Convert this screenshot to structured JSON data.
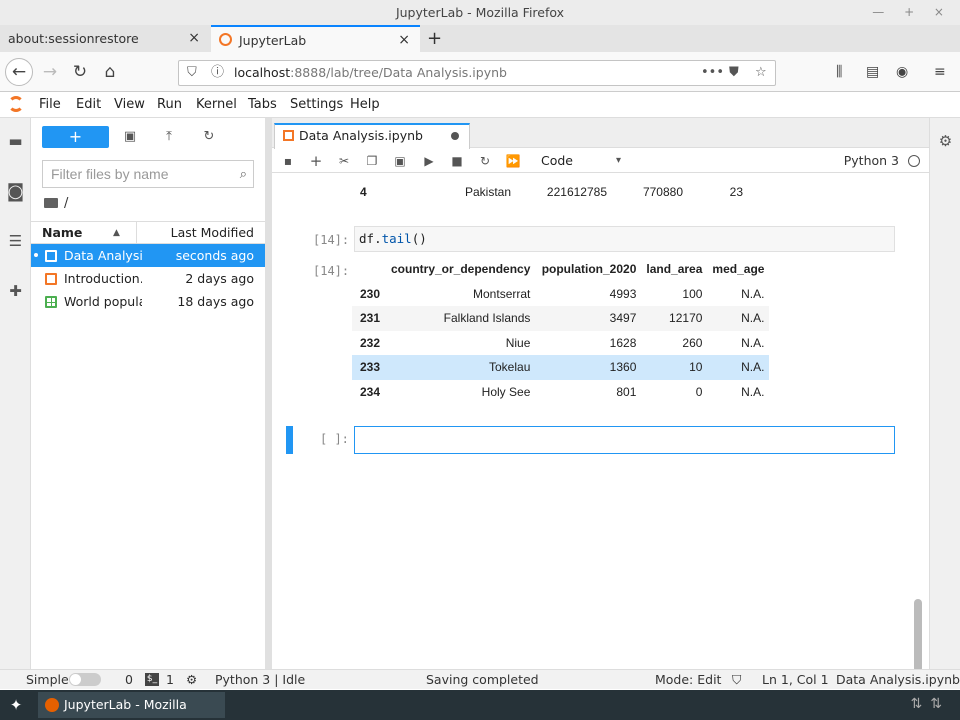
{
  "window": {
    "title": "JupyterLab - Mozilla Firefox",
    "controls": "— + ×"
  },
  "browser_tabs": [
    {
      "label": "about:sessionrestore"
    },
    {
      "label": "JupyterLab"
    }
  ],
  "address_bar": {
    "url_host": "localhost",
    "url_rest": ":8888/lab/tree/Data Analysis.ipynb"
  },
  "menu": [
    "File",
    "Edit",
    "View",
    "Run",
    "Kernel",
    "Tabs",
    "Settings",
    "Help"
  ],
  "file_browser": {
    "filter_placeholder": "Filter files by name",
    "breadcrumb": "/",
    "col_name": "Name",
    "col_modified": "Last Modified",
    "files": [
      {
        "name": "Data Analysis.ipynb",
        "modified": "seconds ago",
        "type": "notebook"
      },
      {
        "name": "Introduction.ipynb",
        "modified": "2 days ago",
        "type": "notebook"
      },
      {
        "name": "World population.csv",
        "modified": "18 days ago",
        "type": "csv"
      }
    ]
  },
  "notebook": {
    "tab_title": "Data Analysis.ipynb",
    "cell_type": "Code",
    "kernel": "Python 3",
    "prev_row": {
      "index": "4",
      "country": "Pakistan",
      "population": "221612785",
      "land_area": "770880",
      "med_age": "23"
    },
    "cell_in_prompt": "[14]:",
    "cell_out_prompt": "[14]:",
    "code_obj": "df",
    "code_method": "tail",
    "code_args": "()",
    "table": {
      "columns": [
        "country_or_dependency",
        "population_2020",
        "land_area",
        "med_age"
      ],
      "rows": [
        {
          "index": "230",
          "country": "Montserrat",
          "population": "4993",
          "land_area": "100",
          "med_age": "N.A."
        },
        {
          "index": "231",
          "country": "Falkland Islands",
          "population": "3497",
          "land_area": "12170",
          "med_age": "N.A."
        },
        {
          "index": "232",
          "country": "Niue",
          "population": "1628",
          "land_area": "260",
          "med_age": "N.A."
        },
        {
          "index": "233",
          "country": "Tokelau",
          "population": "1360",
          "land_area": "10",
          "med_age": "N.A."
        },
        {
          "index": "234",
          "country": "Holy See",
          "population": "801",
          "land_area": "0",
          "med_age": "N.A."
        }
      ]
    },
    "empty_prompt": "[ ]:"
  },
  "statusbar": {
    "mode_label": "Simple",
    "count_a": "0",
    "count_b": "1",
    "kernel_status": "Python 3 | Idle",
    "saving": "Saving completed",
    "mode": "Mode: Edit",
    "cursor": "Ln 1, Col 1",
    "filename": "Data Analysis.ipynb"
  },
  "taskbar": {
    "app_label": "JupyterLab - Mozilla Firefox"
  },
  "colors": {
    "accent": "#2196f3",
    "jupyter_orange": "#f37626",
    "taskbar": "#263238"
  }
}
